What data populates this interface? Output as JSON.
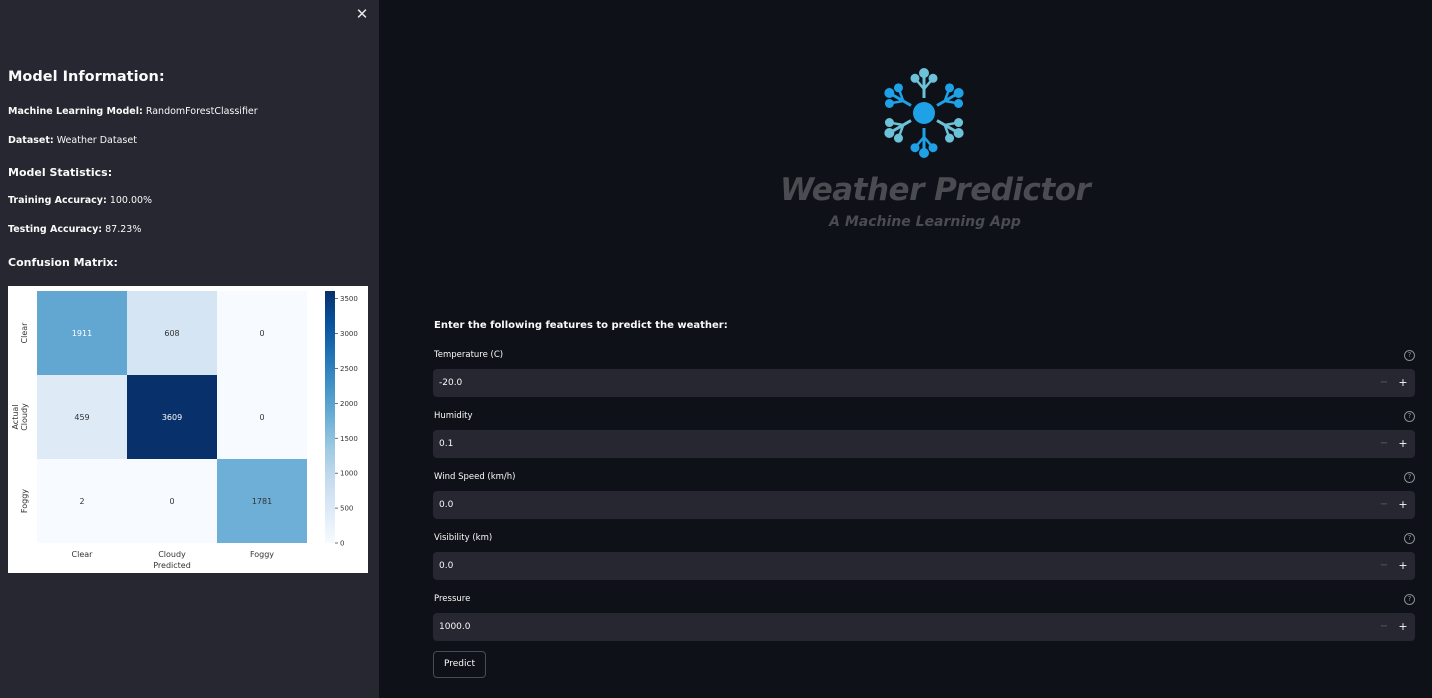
{
  "sidebar": {
    "close_icon": "close-icon",
    "model_info_heading": "Model Information:",
    "model_label": "Machine Learning Model:",
    "model_value": "RandomForestClassifier",
    "dataset_label": "Dataset:",
    "dataset_value": "Weather Dataset",
    "stats_heading": "Model Statistics:",
    "training_label": "Training Accuracy:",
    "training_value": "100.00%",
    "testing_label": "Testing Accuracy:",
    "testing_value": "87.23%",
    "confusion_heading": "Confusion Matrix:"
  },
  "chart_data": {
    "type": "heatmap",
    "xlabel": "Predicted",
    "ylabel": "Actual",
    "x_categories": [
      "Clear",
      "Cloudy",
      "Foggy"
    ],
    "y_categories": [
      "Clear",
      "Cloudy",
      "Foggy"
    ],
    "values": [
      [
        1911,
        608,
        0
      ],
      [
        459,
        3609,
        0
      ],
      [
        2,
        0,
        1781
      ]
    ],
    "colorbar_ticks": [
      0,
      500,
      1000,
      1500,
      2000,
      2500,
      3000,
      3500
    ],
    "colormap": "Blues",
    "vmin": 0,
    "vmax": 3609
  },
  "logo": {
    "title": "Weather Predictor",
    "subtitle": "A Machine Learning App",
    "icon": "weather-network-icon",
    "accent_color": "#1ea1e6",
    "accent_light": "#6cc3d9"
  },
  "form": {
    "heading": "Enter the following features to predict the weather:",
    "fields": [
      {
        "label": "Temperature (C)",
        "value": "-20.0"
      },
      {
        "label": "Humidity",
        "value": "0.1"
      },
      {
        "label": "Wind Speed (km/h)",
        "value": "0.0"
      },
      {
        "label": "Visibility (km)",
        "value": "0.0"
      },
      {
        "label": "Pressure",
        "value": "1000.0"
      }
    ],
    "minus_glyph": "−",
    "plus_glyph": "+",
    "help_glyph": "?",
    "predict_label": "Predict"
  }
}
